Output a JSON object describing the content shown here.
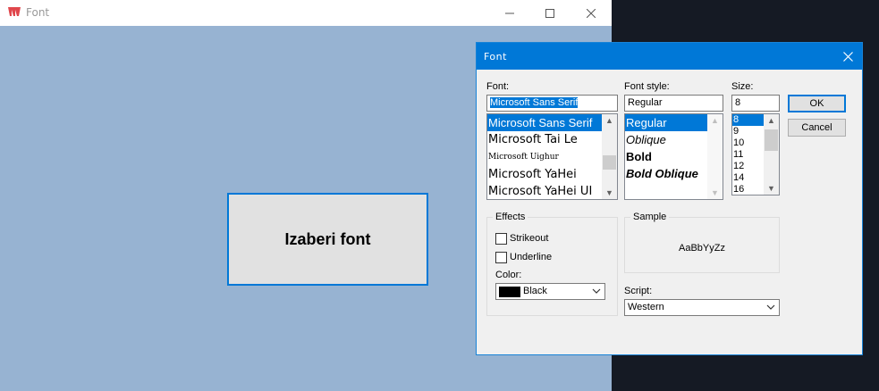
{
  "app": {
    "title": "Font",
    "main_button_label": "Izaberi font"
  },
  "dialog": {
    "title": "Font",
    "font_label": "Font:",
    "font_value": "Microsoft Sans Serif",
    "font_list": [
      {
        "label": "Microsoft Sans Serif",
        "selected": true
      },
      {
        "label": "Microsoft Tai Le",
        "selected": false
      },
      {
        "label": "Microsoft Uighur",
        "selected": false
      },
      {
        "label": "Microsoft YaHei",
        "selected": false
      },
      {
        "label": "Microsoft YaHei UI",
        "selected": false
      }
    ],
    "style_label": "Font style:",
    "style_value": "Regular",
    "style_list": [
      {
        "label": "Regular",
        "selected": true
      },
      {
        "label": "Oblique",
        "selected": false
      },
      {
        "label": "Bold",
        "selected": false
      },
      {
        "label": "Bold Oblique",
        "selected": false
      }
    ],
    "size_label": "Size:",
    "size_value": "8",
    "size_list": [
      {
        "label": "8",
        "selected": true
      },
      {
        "label": "9",
        "selected": false
      },
      {
        "label": "10",
        "selected": false
      },
      {
        "label": "11",
        "selected": false
      },
      {
        "label": "12",
        "selected": false
      },
      {
        "label": "14",
        "selected": false
      },
      {
        "label": "16",
        "selected": false
      }
    ],
    "ok_label": "OK",
    "cancel_label": "Cancel",
    "effects_title": "Effects",
    "strikeout_label": "Strikeout",
    "underline_label": "Underline",
    "color_label": "Color:",
    "color_value": "Black",
    "sample_title": "Sample",
    "sample_text": "AaBbYyZz",
    "script_label": "Script:",
    "script_value": "Western"
  },
  "colors": {
    "accent": "#0078d7",
    "app_background": "#97b3d2",
    "desktop": "#151a24"
  }
}
